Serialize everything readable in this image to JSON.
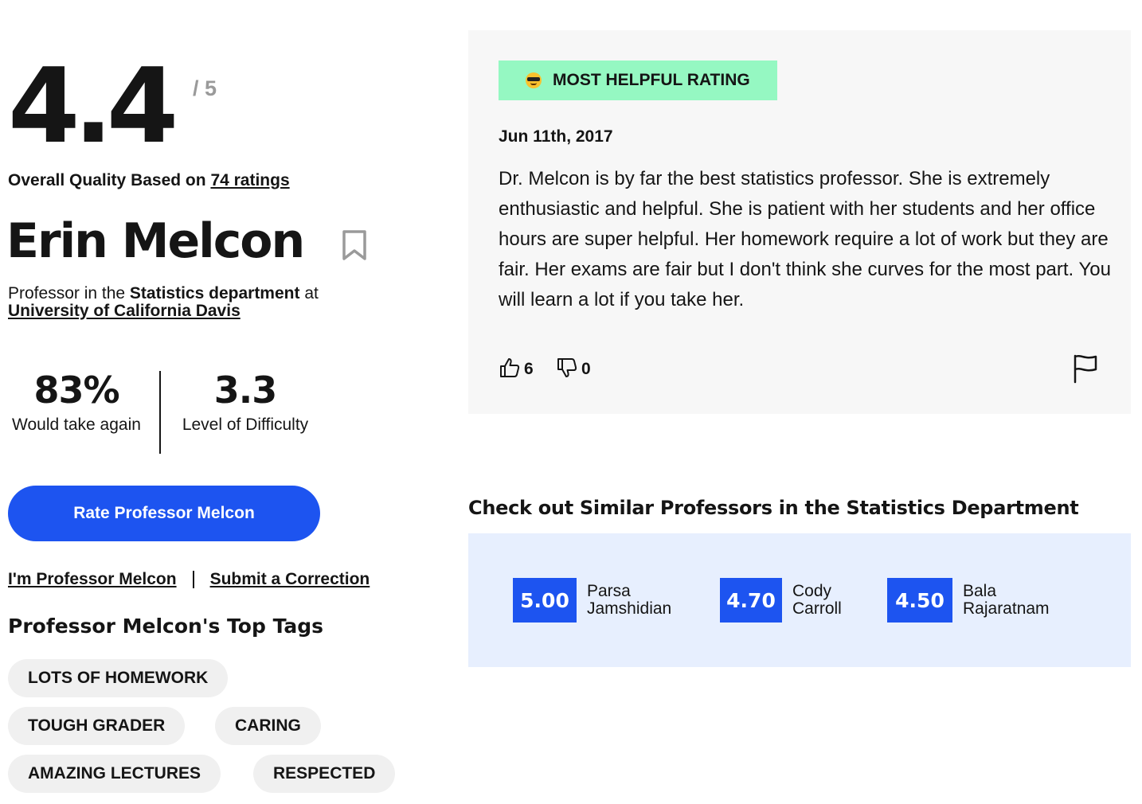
{
  "rating": {
    "value": "4.4",
    "max": "/ 5"
  },
  "quality": {
    "prefix": "Overall Quality Based on",
    "ratings_link": "74 ratings"
  },
  "professor": {
    "name": "Erin Melcon",
    "role_prefix": "Professor in the",
    "department": "Statistics department",
    "at": "at",
    "university": "University of California Davis"
  },
  "stats": {
    "would_take_again": {
      "value": "83%",
      "label": "Would take again"
    },
    "difficulty": {
      "value": "3.3",
      "label": "Level of Difficulty"
    }
  },
  "actions": {
    "rate_button": "Rate Professor Melcon",
    "claim_link": "I'm Professor Melcon",
    "correction_link": "Submit a Correction"
  },
  "tags": {
    "heading": "Professor Melcon's Top Tags",
    "items": [
      "LOTS OF HOMEWORK",
      "TOUGH GRADER",
      "CARING",
      "AMAZING LECTURES",
      "RESPECTED"
    ]
  },
  "helpful_rating": {
    "badge": "MOST HELPFUL RATING",
    "badge_icon": "sunglasses-emoji-icon",
    "date": "Jun 11th, 2017",
    "text": "Dr. Melcon is by far the best statistics professor. She is extremely enthusiastic and helpful. She is patient with her students and her office hours are super helpful. Her homework require a lot of work but they are fair. Her exams are fair but I don't think she curves for the most part. You will learn a lot if you take her.",
    "thumbs_up": "6",
    "thumbs_down": "0"
  },
  "similar": {
    "heading": "Check out Similar Professors in the Statistics Department",
    "professors": [
      {
        "score": "5.00",
        "first": "Parsa",
        "last": "Jamshidian"
      },
      {
        "score": "4.70",
        "first": "Cody",
        "last": "Carroll"
      },
      {
        "score": "4.50",
        "first": "Bala",
        "last": "Rajaratnam"
      }
    ]
  },
  "colors": {
    "accent_blue": "#1d54f0",
    "badge_green": "#95f8c2",
    "similar_bg": "#e7effe",
    "card_bg": "#f7f7f7",
    "tag_bg": "#f0f0f0"
  }
}
